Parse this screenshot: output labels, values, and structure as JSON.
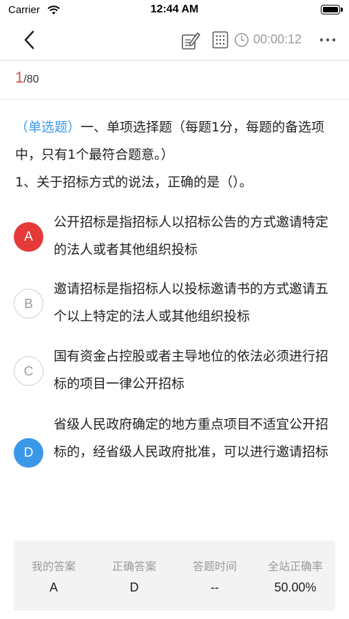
{
  "status_bar": {
    "carrier": "Carrier",
    "time": "12:44 AM"
  },
  "nav": {
    "back_icon": "chevron-left-icon",
    "edit_icon": "edit-note-icon",
    "grid_icon": "answer-sheet-grid-icon",
    "clock_icon": "clock-icon",
    "timer": "00:00:12",
    "more_icon": "more-horizontal-icon"
  },
  "progress": {
    "current": "1",
    "total": "/80"
  },
  "question": {
    "type_label": "（单选题）",
    "section": "一、单项选择题（每题1分，每题的备选项中，只有1个最符合题意。）",
    "stem": "1、关于招标方式的说法，正确的是（）。"
  },
  "options": [
    {
      "letter": "A",
      "state": "wrong",
      "text": "公开招标是指招标人以招标公告的方式邀请特定的法人或者其他组织投标"
    },
    {
      "letter": "B",
      "state": "plain",
      "text": "邀请招标是指招标人以投标邀请书的方式邀请五个以上特定的法人或其他组织投标"
    },
    {
      "letter": "C",
      "state": "plain",
      "text": "国有资金占控股或者主导地位的依法必须进行招标的项目一律公开招标"
    },
    {
      "letter": "D",
      "state": "correct",
      "text": "省级人民政府确定的地方重点项目不适宜公开招标的，经省级人民政府批准，可以进行邀请招标"
    }
  ],
  "answer_panel": {
    "my_answer_label": "我的答案",
    "my_answer": "A",
    "correct_answer_label": "正确答案",
    "correct_answer": "D",
    "time_label": "答题时间",
    "time_value": "--",
    "site_rate_label": "全站正确率",
    "site_rate": "50.00%"
  },
  "colors": {
    "wrong": "#e53a3a",
    "correct": "#3a98e8",
    "progress_current": "#e34a4a",
    "muted": "#9a9a9a"
  }
}
